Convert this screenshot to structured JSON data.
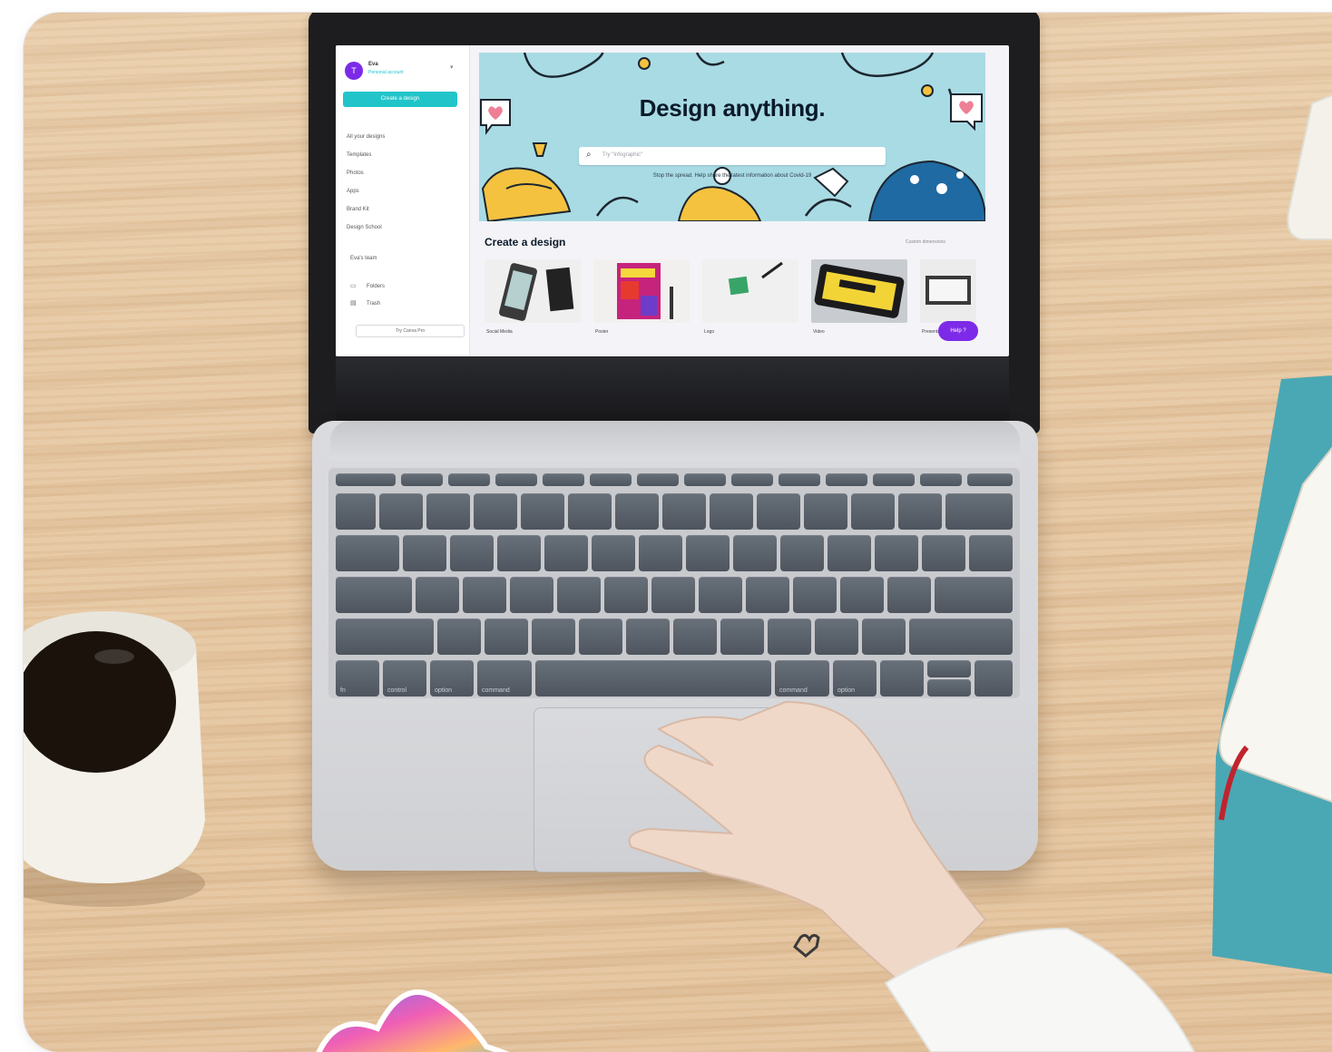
{
  "screen": {
    "account": {
      "avatar_letter": "T",
      "name": "Eva",
      "subtitle": "Personal account"
    },
    "create_button": "Create a design",
    "sidebar_items": [
      "All your designs",
      "Templates",
      "Photos",
      "Apps",
      "Brand Kit",
      "Design School"
    ],
    "team_label": "Eva's team",
    "folder_items": [
      "Folders",
      "Trash"
    ],
    "pro_button": "Try Canva Pro",
    "hero": {
      "title": "Design anything.",
      "search_placeholder": "Try \"Infographic\"",
      "note": "Stop the spread. Help share the latest information about Covid-19"
    },
    "section": {
      "title": "Create a design",
      "link": "Custom dimensions"
    },
    "thumbnails": [
      "Social Media",
      "Poster",
      "Logo",
      "Video",
      "Presentation"
    ],
    "help_button": "Help ?"
  },
  "keyboard": {
    "bottom_row": [
      "fn",
      "control",
      "option",
      "command",
      "",
      "command",
      "option"
    ]
  },
  "colors": {
    "canva_teal": "#21c5c9",
    "canva_purple": "#7d2ae8",
    "desk_wood": "#e6c7a1"
  }
}
